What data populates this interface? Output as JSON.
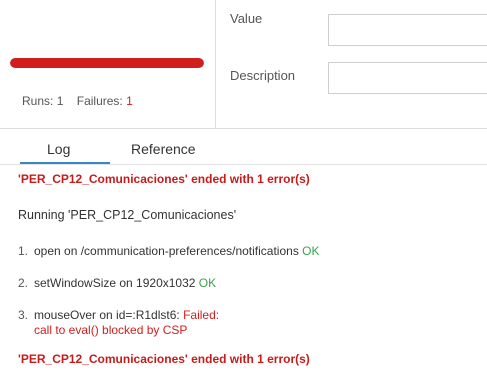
{
  "progress": {
    "fraction": 1.0,
    "color": "#d21d1d",
    "runs_label": "Runs:",
    "runs_value": "1",
    "failures_label": "Failures:",
    "failures_value": "1"
  },
  "fields": {
    "value_label": "Value",
    "value_input": "",
    "description_label": "Description",
    "description_input": ""
  },
  "tabs": [
    {
      "label": "Log",
      "active": true
    },
    {
      "label": "Reference",
      "active": false
    }
  ],
  "log": {
    "summary_top": "'PER_CP12_Comunicaciones' ended with 1 error(s)",
    "running": "Running 'PER_CP12_Comunicaciones'",
    "items": [
      {
        "num": "1.",
        "text": "open on /communication-preferences/notifications",
        "status": "OK"
      },
      {
        "num": "2.",
        "text": "setWindowSize on 1920x1032",
        "status": "OK"
      },
      {
        "num": "3.",
        "text": "mouseOver on id=:R1dlst6:",
        "status": "Failed:",
        "detail": "call to eval() blocked by CSP"
      }
    ],
    "summary_bottom": "'PER_CP12_Comunicaciones' ended with 1 error(s)"
  },
  "colors": {
    "accent_tab": "#3a85c8",
    "error": "#d21d1d",
    "ok": "#3aa24a"
  }
}
